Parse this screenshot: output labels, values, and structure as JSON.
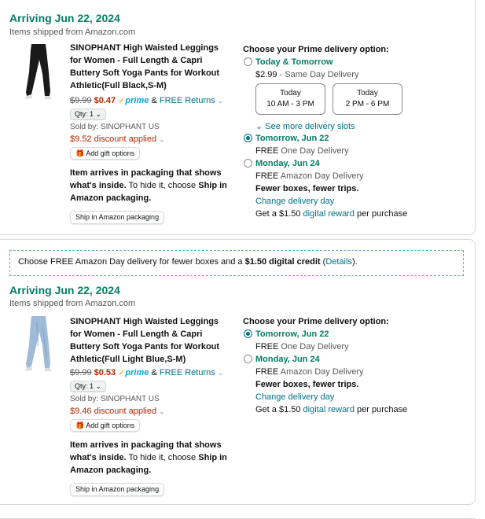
{
  "shipment1": {
    "arriving": "Arriving Jun 22, 2024",
    "shipped_from": "Items shipped from Amazon.com",
    "product": {
      "title": "SINOPHANT High Waisted Leggings for Women - Full Length & Capri Buttery Soft Yoga Pants for Workout Athletic(Full Black,S-M)",
      "list_price": "$9.99",
      "price": "$0.47",
      "prime": "prime",
      "amp": "&",
      "returns": "FREE Returns",
      "qty": "Qty: 1",
      "sold_by": "Sold by: SINOPHANT US",
      "discount": "$9.52 discount applied",
      "gift": "Add gift options",
      "pkg_line1": "Item arrives in packaging that shows",
      "pkg_line2_bold": "what's inside.",
      "pkg_line2_normal": " To hide it, choose ",
      "pkg_line2_bold2": "Ship in",
      "pkg_line3": "Amazon packaging.",
      "ship_btn": "Ship in Amazon packaging",
      "color": "#1a1a1a"
    },
    "delivery": {
      "heading": "Choose your Prime delivery option:",
      "opt1_title": "Today & Tomorrow",
      "opt1_price": "$2.99",
      "opt1_sep": " - Same Day Delivery",
      "slot1_day": "Today",
      "slot1_time": "10 AM - 3 PM",
      "slot2_day": "Today",
      "slot2_time": "2 PM - 6 PM",
      "see_more": "See more delivery slots",
      "opt2_title": "Tomorrow, Jun 22",
      "opt2_free": "FREE",
      "opt2_desc": " One Day Delivery",
      "opt3_title": "Monday, Jun 24",
      "opt3_free": "FREE",
      "opt3_desc": " Amazon Day Delivery",
      "opt3_bold": "Fewer boxes, fewer trips.",
      "opt3_link": "Change delivery day",
      "reward_a": "Get a $1.50 ",
      "reward_link": "digital reward",
      "reward_b": " per purchase"
    }
  },
  "promo": {
    "text_a": "Choose FREE Amazon Day delivery for fewer boxes and a ",
    "text_bold": "$1.50 digital credit",
    "text_b": " (",
    "details": "Details",
    "text_c": ")."
  },
  "shipment2": {
    "arriving": "Arriving Jun 22, 2024",
    "shipped_from": "Items shipped from Amazon.com",
    "product": {
      "title": "SINOPHANT High Waisted Leggings for Women - Full Length & Capri Buttery Soft Yoga Pants for Workout Athletic(Full Light Blue,S-M)",
      "list_price": "$9.99",
      "price": "$0.53",
      "prime": "prime",
      "amp": "&",
      "returns": "FREE Returns",
      "qty": "Qty: 1",
      "sold_by": "Sold by: SINOPHANT US",
      "discount": "$9.46 discount applied",
      "gift": "Add gift options",
      "pkg_line1": "Item arrives in packaging that shows",
      "pkg_line2_bold": "what's inside.",
      "pkg_line2_normal": " To hide it, choose ",
      "pkg_line2_bold2": "Ship in",
      "pkg_line3": "Amazon packaging.",
      "ship_btn": "Ship in Amazon packaging",
      "color": "#9fbbd8"
    },
    "delivery": {
      "heading": "Choose your Prime delivery option:",
      "opt2_title": "Tomorrow, Jun 22",
      "opt2_free": "FREE",
      "opt2_desc": " One Day Delivery",
      "opt3_title": "Monday, Jun 24",
      "opt3_free": "FREE",
      "opt3_desc": " Amazon Day Delivery",
      "opt3_bold": "Fewer boxes, fewer trips.",
      "opt3_link": "Change delivery day",
      "reward_a": "Get a $1.50 ",
      "reward_link": "digital reward",
      "reward_b": " per purchase"
    }
  }
}
